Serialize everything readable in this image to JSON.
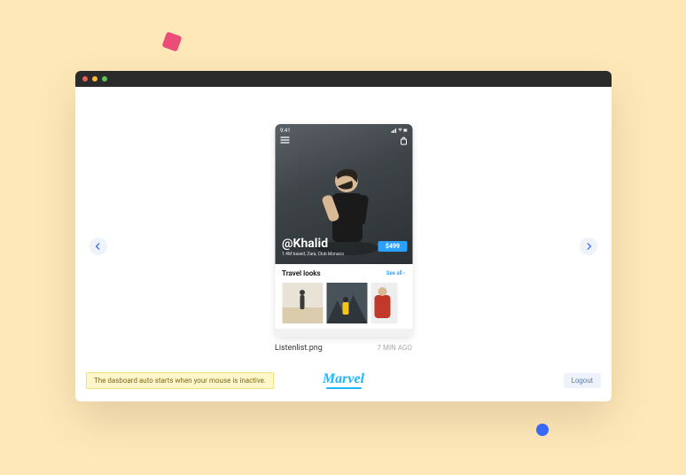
{
  "phone": {
    "time": "9:41",
    "handle": "@Khalid",
    "followers": "1.4M based, Zara, Club Monaco",
    "price": "$499",
    "section_title": "Travel looks",
    "see_all": "See all ›"
  },
  "caption": {
    "filename": "Listenlist.png",
    "timestamp": "7 MIN AGO"
  },
  "toast": "The dasboard auto starts when your mouse is inactive.",
  "brand": "Marvel",
  "logout": "Logout"
}
